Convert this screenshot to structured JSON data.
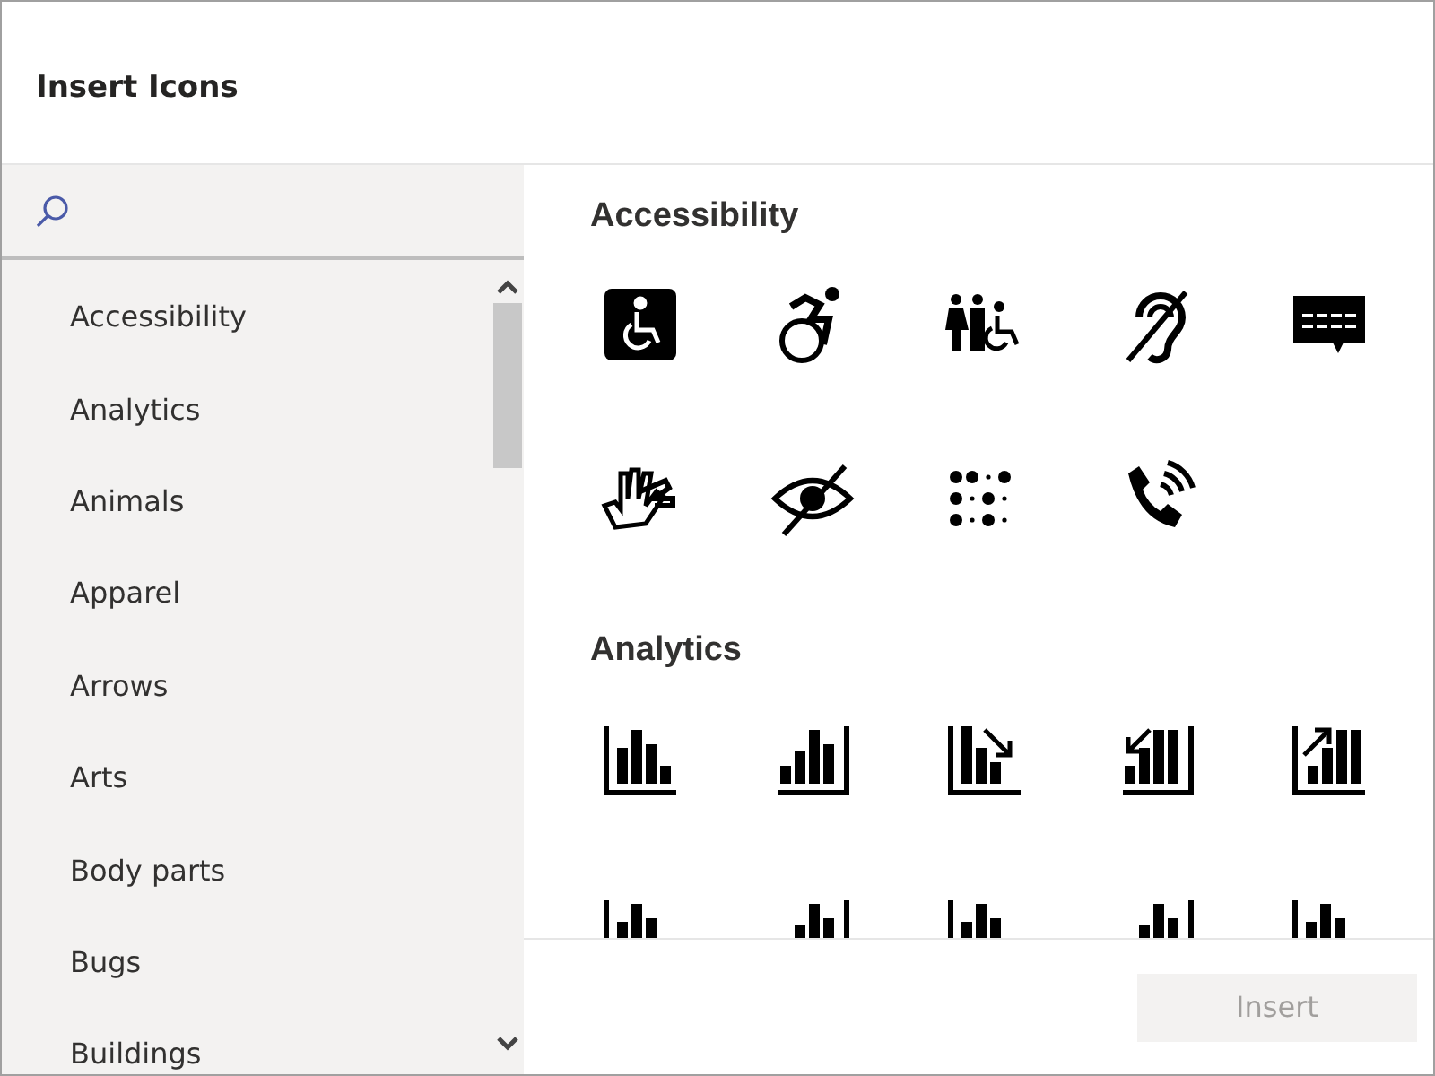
{
  "dialog": {
    "title": "Insert Icons"
  },
  "categories": [
    {
      "label": "Accessibility",
      "selected": false
    },
    {
      "label": "Analytics",
      "selected": false
    },
    {
      "label": "Animals",
      "selected": false
    },
    {
      "label": "Apparel",
      "selected": false
    },
    {
      "label": "Arrows",
      "selected": false
    },
    {
      "label": "Arts",
      "selected": false
    },
    {
      "label": "Body parts",
      "selected": false
    },
    {
      "label": "Bugs",
      "selected": false
    },
    {
      "label": "Buildings",
      "selected": false
    }
  ],
  "sections": [
    {
      "title": "Accessibility",
      "icons": [
        {
          "kind": "wheelchair-sign"
        },
        {
          "kind": "wheelchair-active"
        },
        {
          "kind": "restroom"
        },
        {
          "kind": "hearing-off"
        },
        {
          "kind": "caption"
        },
        {
          "kind": "sign-language"
        },
        {
          "kind": "eye-off"
        },
        {
          "kind": "braille"
        },
        {
          "kind": "phone-volume"
        }
      ]
    },
    {
      "title": "Analytics",
      "icons": [
        {
          "kind": "bars"
        },
        {
          "kind": "bars-rising"
        },
        {
          "kind": "bars-down-arrow"
        },
        {
          "kind": "bars-in-arrow"
        },
        {
          "kind": "bars-up-arrow"
        },
        {
          "kind": "bars"
        },
        {
          "kind": "bars-rising"
        },
        {
          "kind": "bars"
        },
        {
          "kind": "bars-rising"
        },
        {
          "kind": "bars"
        }
      ]
    }
  ],
  "insert_button": {
    "label": "Insert",
    "disabled": true
  }
}
